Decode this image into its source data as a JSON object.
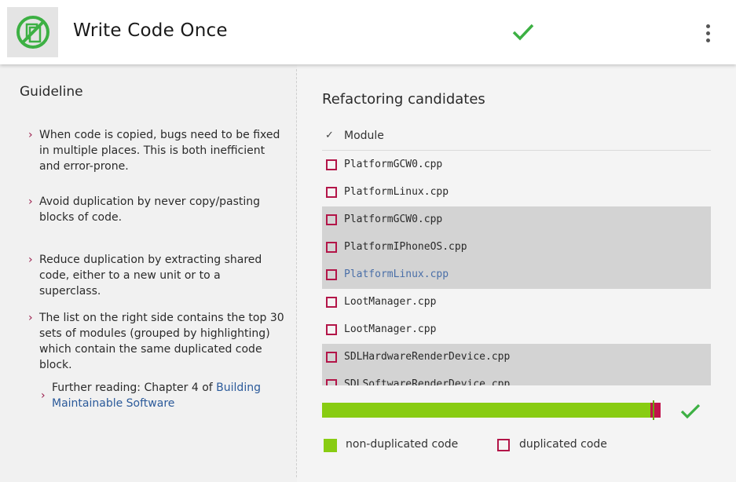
{
  "header": {
    "title": "Write Code Once",
    "logo_icon": "no-copy-icon",
    "status_icon": "checkmark-icon",
    "menu_icon": "more-vert-icon",
    "accent": "#3cb043"
  },
  "guideline": {
    "title": "Guideline",
    "bullets": [
      "When code is copied, bugs need to be fixed in multiple places. This is both inefficient and error-prone.",
      "Avoid duplication by never copy/pasting blocks of code.",
      "Reduce duplication by extracting shared code, either to a new unit or to a superclass.",
      "The list on the right side contains the top 30 sets of modules (grouped by highlighting) which contain the same duplicated code block."
    ],
    "further_prefix": "Further reading: Chapter 4 of ",
    "further_link": "Building Maintainable Software"
  },
  "candidates": {
    "title": "Refactoring candidates",
    "column_header": "Module",
    "rows": [
      {
        "name": "PlatformGCW0.cpp",
        "highlighted": false,
        "link": false
      },
      {
        "name": "PlatformLinux.cpp",
        "highlighted": false,
        "link": false
      },
      {
        "name": "PlatformGCW0.cpp",
        "highlighted": true,
        "link": false
      },
      {
        "name": "PlatformIPhoneOS.cpp",
        "highlighted": true,
        "link": false
      },
      {
        "name": "PlatformLinux.cpp",
        "highlighted": true,
        "link": true
      },
      {
        "name": "LootManager.cpp",
        "highlighted": false,
        "link": false
      },
      {
        "name": "LootManager.cpp",
        "highlighted": false,
        "link": false
      },
      {
        "name": "SDLHardwareRenderDevice.cpp",
        "highlighted": true,
        "link": false
      },
      {
        "name": "SDLSoftwareRenderDevice.cpp",
        "highlighted": true,
        "link": false
      }
    ]
  },
  "progress": {
    "non_duplicated_fraction": 0.97,
    "duplicated_fraction": 0.03,
    "green": "#88cc12",
    "red": "#c0134a"
  },
  "legend": {
    "non_duplicated": "non-duplicated code",
    "duplicated": "duplicated code"
  }
}
